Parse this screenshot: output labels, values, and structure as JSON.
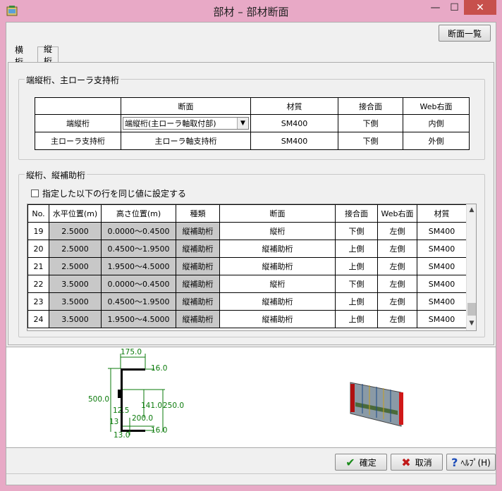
{
  "window": {
    "title": "部材 – 部材断面",
    "min_symbol": "—",
    "max_symbol": "☐",
    "close_symbol": "✕"
  },
  "toolbar": {
    "section_list_label": "断面一覧"
  },
  "tabs": [
    {
      "label": "横桁",
      "active": false
    },
    {
      "label": "縦桁",
      "active": true
    }
  ],
  "group1": {
    "title": "端縦桁、主ローラ支持桁",
    "headers": [
      "",
      "断面",
      "材質",
      "接合面",
      "Web右面"
    ],
    "rows": [
      {
        "name": "端縦桁",
        "section": "端縦桁(主ローラ軸取付部)",
        "material": "SM400",
        "face": "下側",
        "web": "内側"
      },
      {
        "name": "主ローラ支持桁",
        "section": "主ローラ軸支持桁",
        "material": "SM400",
        "face": "下側",
        "web": "外側"
      }
    ]
  },
  "group2": {
    "title": "縦桁、縦補助桁",
    "checkbox_label": "指定した以下の行を同じ値に設定する",
    "headers": [
      "No.",
      "水平位置(m)",
      "高さ位置(m)",
      "種類",
      "断面",
      "接合面",
      "Web右面",
      "材質"
    ],
    "rows": [
      {
        "no": "19",
        "h": "2.5000",
        "z": "0.0000～0.4500",
        "kind": "縦補助桁",
        "section": "縦桁",
        "face": "下側",
        "web": "左側",
        "material": "SM400"
      },
      {
        "no": "20",
        "h": "2.5000",
        "z": "0.4500～1.9500",
        "kind": "縦補助桁",
        "section": "縦補助桁",
        "face": "上側",
        "web": "左側",
        "material": "SM400"
      },
      {
        "no": "21",
        "h": "2.5000",
        "z": "1.9500～4.5000",
        "kind": "縦補助桁",
        "section": "縦補助桁",
        "face": "上側",
        "web": "左側",
        "material": "SM400"
      },
      {
        "no": "22",
        "h": "3.5000",
        "z": "0.0000～0.4500",
        "kind": "縦補助桁",
        "section": "縦桁",
        "face": "下側",
        "web": "左側",
        "material": "SM400"
      },
      {
        "no": "23",
        "h": "3.5000",
        "z": "0.4500～1.9500",
        "kind": "縦補助桁",
        "section": "縦補助桁",
        "face": "上側",
        "web": "左側",
        "material": "SM400"
      },
      {
        "no": "24",
        "h": "3.5000",
        "z": "1.9500～4.5000",
        "kind": "縦補助桁",
        "section": "縦補助桁",
        "face": "上側",
        "web": "左側",
        "material": "SM400"
      }
    ]
  },
  "drawing": {
    "top_width": "175.0",
    "top_thk": "16.0",
    "height": "500.0",
    "h141": "141.0",
    "h250": "250.0",
    "h200": "200.0",
    "v125": "12.5",
    "v13": "13",
    "v130": "13.0",
    "bot_thk": "16.0"
  },
  "footer": {
    "ok_label": "確定",
    "cancel_label": "取消",
    "help_label": "ﾍﾙﾌﾟ(H)"
  }
}
